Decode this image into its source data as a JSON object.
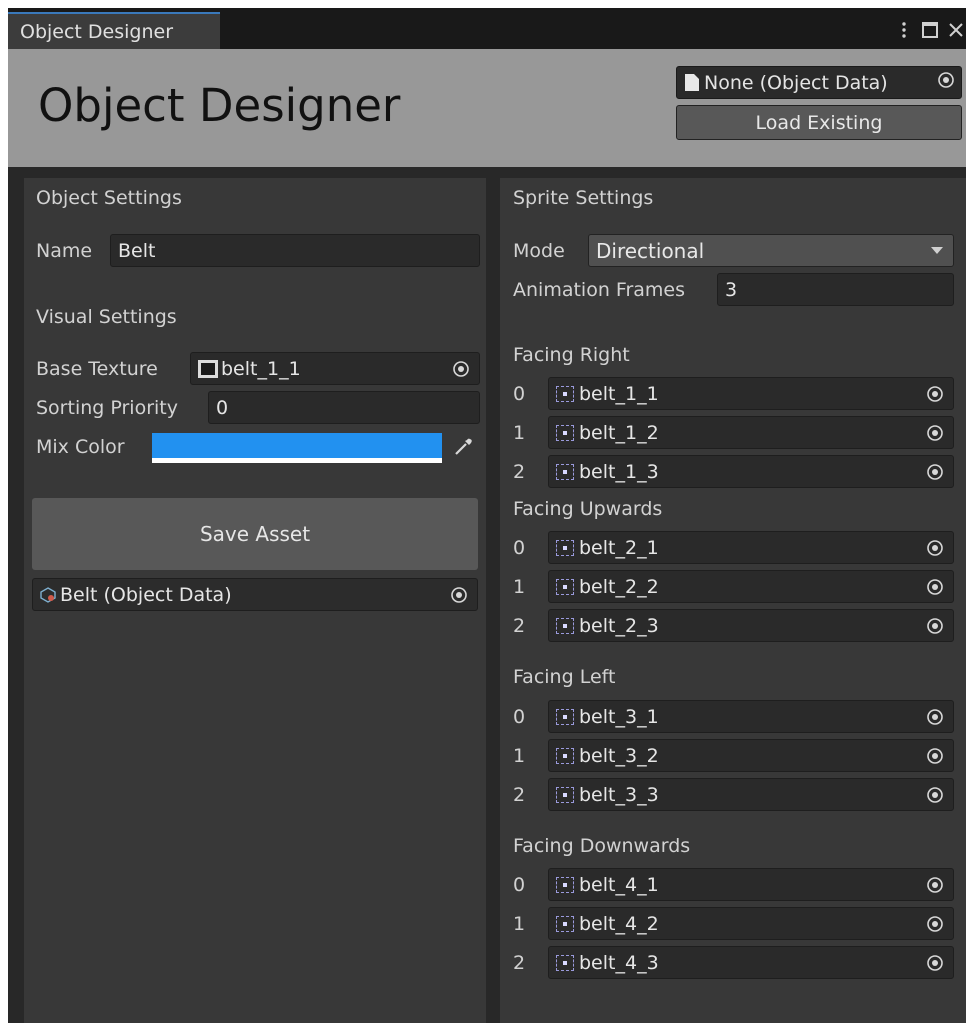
{
  "tab": {
    "title": "Object Designer"
  },
  "header": {
    "title": "Object Designer",
    "object_field": "None (Object Data)",
    "load_button": "Load Existing"
  },
  "object_settings": {
    "heading": "Object Settings",
    "name_label": "Name",
    "name_value": "Belt",
    "visual_heading": "Visual Settings",
    "base_texture_label": "Base Texture",
    "base_texture_value": "belt_1_1",
    "sorting_label": "Sorting Priority",
    "sorting_value": "0",
    "mix_color_label": "Mix Color",
    "mix_color": "#2291f0",
    "save_button": "Save Asset",
    "asset_ref": "Belt (Object Data)"
  },
  "sprite_settings": {
    "heading": "Sprite Settings",
    "mode_label": "Mode",
    "mode_value": "Directional",
    "frames_label": "Animation Frames",
    "frames_value": "3",
    "groups": [
      {
        "label": "Facing Right",
        "frames": [
          {
            "index": "0",
            "sprite": "belt_1_1"
          },
          {
            "index": "1",
            "sprite": "belt_1_2"
          },
          {
            "index": "2",
            "sprite": "belt_1_3"
          }
        ]
      },
      {
        "label": "Facing Upwards",
        "frames": [
          {
            "index": "0",
            "sprite": "belt_2_1"
          },
          {
            "index": "1",
            "sprite": "belt_2_2"
          },
          {
            "index": "2",
            "sprite": "belt_2_3"
          }
        ]
      },
      {
        "label": "Facing Left",
        "frames": [
          {
            "index": "0",
            "sprite": "belt_3_1"
          },
          {
            "index": "1",
            "sprite": "belt_3_2"
          },
          {
            "index": "2",
            "sprite": "belt_3_3"
          }
        ]
      },
      {
        "label": "Facing Downwards",
        "frames": [
          {
            "index": "0",
            "sprite": "belt_4_1"
          },
          {
            "index": "1",
            "sprite": "belt_4_2"
          },
          {
            "index": "2",
            "sprite": "belt_4_3"
          }
        ]
      }
    ]
  }
}
